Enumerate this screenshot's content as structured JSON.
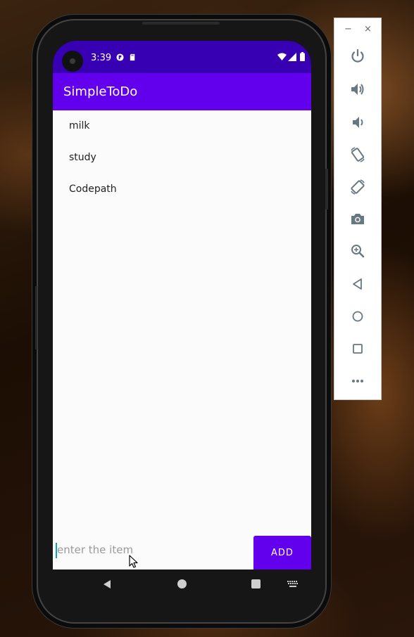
{
  "status_bar": {
    "time": "3:39"
  },
  "app_bar": {
    "title": "SimpleToDo"
  },
  "todo_list": {
    "items": [
      "milk",
      "study",
      "Codepath"
    ]
  },
  "input": {
    "value": "",
    "placeholder": "enter the item"
  },
  "add_button": {
    "label": "ADD"
  },
  "colors": {
    "status_bar": "#3700b3",
    "primary": "#6200ee",
    "content_bg": "#fbfbfb",
    "caret": "#03a9a4"
  },
  "emulator_panel": {
    "window_controls": [
      "minimize-icon",
      "close-icon"
    ],
    "buttons": [
      "power-icon",
      "volume-up-icon",
      "volume-down-icon",
      "rotate-left-icon",
      "rotate-right-icon",
      "camera-icon",
      "zoom-icon",
      "back-icon",
      "home-icon",
      "overview-icon",
      "more-icon"
    ]
  }
}
